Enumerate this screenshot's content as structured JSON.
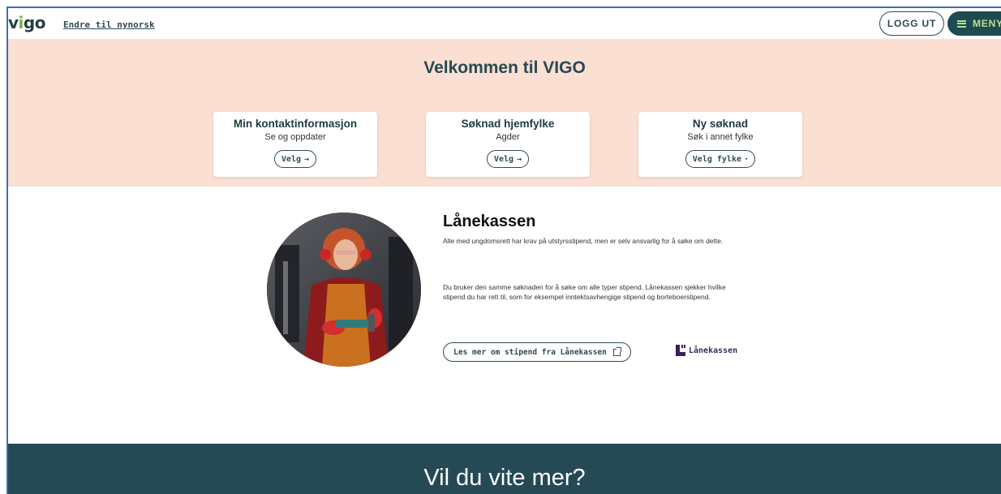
{
  "header": {
    "logo_text": "vigo",
    "lang_link": "Endre til nynorsk",
    "logout_label": "LOGG UT",
    "menu_label": "MENY"
  },
  "hero": {
    "title": "Velkommen til VIGO",
    "cards": [
      {
        "title": "Min kontaktinformasjon",
        "subtitle": "Se og oppdater",
        "button": "Velg"
      },
      {
        "title": "Søknad hjemfylke",
        "subtitle": "Agder",
        "button": "Velg"
      },
      {
        "title": "Ny søknad",
        "subtitle": "Søk i annet fylke",
        "button": "Velg fylke"
      }
    ]
  },
  "lanekassen": {
    "title": "Lånekassen",
    "paragraph1": "Alle med ungdomsrett har krav på utstyrsstipend, men er selv ansvarlig for å søke om dette.",
    "paragraph2": "Du bruker den samme søknaden for å søke om alle typer stipend. Lånekassen sjekker hvilke stipend du har rett til, som for eksempel inntektsavhengige stipend og borteboerstipend.",
    "more_link": "Les mer om stipend fra Lånekassen",
    "logo_text": "Lånekassen"
  },
  "footer": {
    "title": "Vil du vite mer?"
  },
  "colors": {
    "hero_bg": "#fbdfd2",
    "footer_bg": "#254a56",
    "menu_bg": "#1e4a52",
    "accent_green": "#7bb043"
  }
}
